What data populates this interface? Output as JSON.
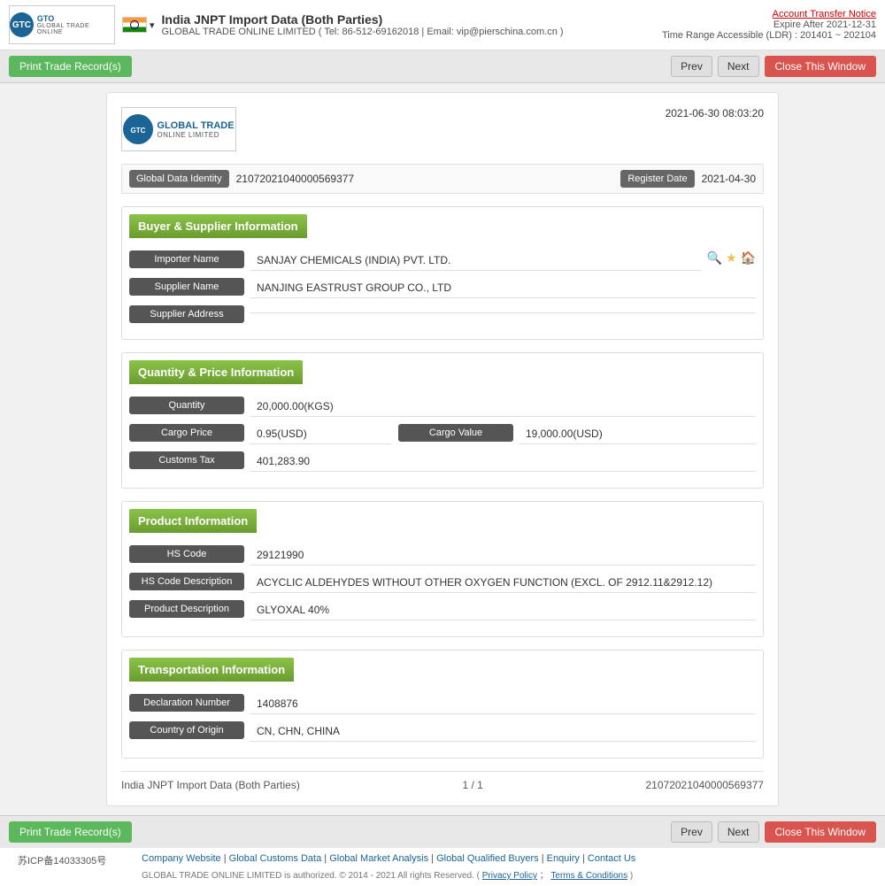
{
  "header": {
    "logo_text": "GTC",
    "logo_subtext": "GLOBAL TRADE ONLINE LIMITED",
    "title": "India JNPT Import Data (Both Parties)",
    "subtitle": "GLOBAL TRADE ONLINE LIMITED ( Tel: 86-512-69162018 | Email: vip@pierschina.com.cn )",
    "expire_link": "Account Transfer Notice",
    "expire": "Expire After 2021-12-31",
    "time_range": "Time Range Accessible (LDR) : 201401 ~ 202104"
  },
  "toolbar": {
    "print_label": "Print Trade Record(s)",
    "prev_label": "Prev",
    "next_label": "Next",
    "close_label": "Close This Window"
  },
  "card": {
    "datetime": "2021-06-30 08:03:20",
    "global_data_identity_label": "Global Data Identity",
    "global_data_identity_value": "21072021040000569377",
    "register_date_label": "Register Date",
    "register_date_value": "2021-04-30",
    "buyer_supplier_section": "Buyer & Supplier Information",
    "importer_name_label": "Importer Name",
    "importer_name_value": "SANJAY CHEMICALS (INDIA) PVT. LTD.",
    "supplier_name_label": "Supplier Name",
    "supplier_name_value": "NANJING EASTRUST GROUP CO., LTD",
    "supplier_address_label": "Supplier Address",
    "supplier_address_value": "",
    "quantity_price_section": "Quantity & Price Information",
    "quantity_label": "Quantity",
    "quantity_value": "20,000.00(KGS)",
    "cargo_price_label": "Cargo Price",
    "cargo_price_value": "0.95(USD)",
    "cargo_value_label": "Cargo Value",
    "cargo_value_value": "19,000.00(USD)",
    "customs_tax_label": "Customs Tax",
    "customs_tax_value": "401,283.90",
    "product_section": "Product Information",
    "hs_code_label": "HS Code",
    "hs_code_value": "29121990",
    "hs_code_desc_label": "HS Code Description",
    "hs_code_desc_value": "ACYCLIC ALDEHYDES WITHOUT OTHER OXYGEN FUNCTION (EXCL. OF 2912.11&2912.12)",
    "product_desc_label": "Product Description",
    "product_desc_value": "GLYOXAL 40%",
    "transport_section": "Transportation Information",
    "declaration_number_label": "Declaration Number",
    "declaration_number_value": "1408876",
    "country_of_origin_label": "Country of Origin",
    "country_of_origin_value": "CN, CHN, CHINA",
    "footer_title": "India JNPT Import Data (Both Parties)",
    "footer_page": "1 / 1",
    "footer_id": "21072021040000569377"
  },
  "footer": {
    "icp": "苏ICP备14033305号",
    "links": [
      "Company Website",
      "Global Customs Data",
      "Global Market Analysis",
      "Global Qualified Buyers",
      "Enquiry",
      "Contact Us"
    ],
    "copyright": "GLOBAL TRADE ONLINE LIMITED is authorized. © 2014 - 2021 All rights Reserved. (",
    "privacy": "Privacy Policy",
    "separator": "；",
    "terms": "Terms & Conditions",
    "copyright_end": ")"
  }
}
